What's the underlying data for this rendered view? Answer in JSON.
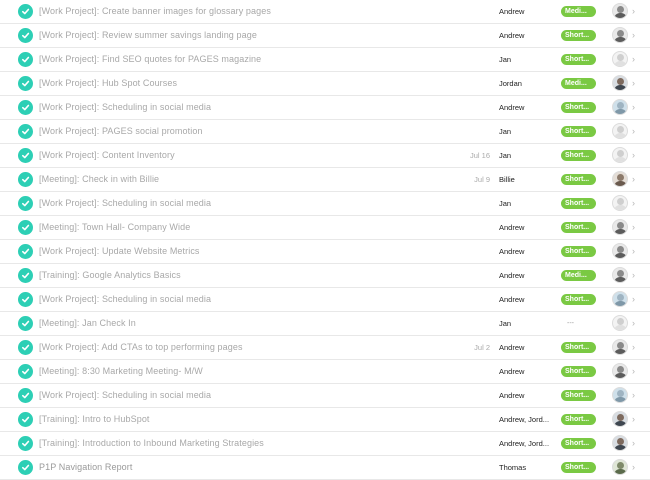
{
  "tasks": [
    {
      "name": "[Work Project]: Create banner images for glossary pages",
      "due": "",
      "assignee": "Andrew",
      "tag": "Medi...",
      "avatar": "andrew"
    },
    {
      "name": "[Work Project]: Review summer savings landing page",
      "due": "",
      "assignee": "Andrew",
      "tag": "Short...",
      "avatar": "andrew"
    },
    {
      "name": "[Work Project]: Find SEO quotes for PAGES magazine",
      "due": "",
      "assignee": "Jan",
      "tag": "Short...",
      "avatar": "jan"
    },
    {
      "name": "[Work Project]: Hub Spot Courses",
      "due": "",
      "assignee": "Jordan",
      "tag": "Medi...",
      "avatar": "jordan"
    },
    {
      "name": "[Work Project]: Scheduling in social media",
      "due": "",
      "assignee": "Andrew",
      "tag": "Short...",
      "avatar": "social"
    },
    {
      "name": "[Work Project]: PAGES social promotion",
      "due": "",
      "assignee": "Jan",
      "tag": "Short...",
      "avatar": "jan"
    },
    {
      "name": "[Work Project]: Content Inventory",
      "due": "Jul 16",
      "assignee": "Jan",
      "tag": "Short...",
      "avatar": "jan"
    },
    {
      "name": "[Meeting]: Check in with Billie",
      "due": "Jul 9",
      "assignee": "Billie",
      "tag": "Short...",
      "avatar": "billie"
    },
    {
      "name": "[Work Project]: Scheduling in social media",
      "due": "",
      "assignee": "Jan",
      "tag": "Short...",
      "avatar": "jan"
    },
    {
      "name": "[Meeting]: Town Hall- Company Wide",
      "due": "",
      "assignee": "Andrew",
      "tag": "Short...",
      "avatar": "andrew"
    },
    {
      "name": "[Work Project]: Update Website Metrics",
      "due": "",
      "assignee": "Andrew",
      "tag": "Short...",
      "avatar": "andrew"
    },
    {
      "name": "[Training]: Google Analytics Basics",
      "due": "",
      "assignee": "Andrew",
      "tag": "Medi...",
      "avatar": "andrew"
    },
    {
      "name": "[Work Project]: Scheduling in social media",
      "due": "",
      "assignee": "Andrew",
      "tag": "Short...",
      "avatar": "social"
    },
    {
      "name": "[Meeting]: Jan Check In",
      "due": "",
      "assignee": "Jan",
      "tag": "---",
      "avatar": "jan"
    },
    {
      "name": "[Work Project]: Add CTAs to top performing pages",
      "due": "Jul 2",
      "assignee": "Andrew",
      "tag": "Short...",
      "avatar": "andrew"
    },
    {
      "name": "[Meeting]: 8:30 Marketing Meeting- M/W",
      "due": "",
      "assignee": "Andrew",
      "tag": "Short...",
      "avatar": "andrew"
    },
    {
      "name": "[Work Project]: Scheduling in social media",
      "due": "",
      "assignee": "Andrew",
      "tag": "Short...",
      "avatar": "social"
    },
    {
      "name": "[Training]: Intro to HubSpot",
      "due": "",
      "assignee": "Andrew, Jord...",
      "tag": "Short...",
      "avatar": "jordan"
    },
    {
      "name": "[Training]: Introduction to Inbound Marketing Strategies",
      "due": "",
      "assignee": "Andrew, Jord...",
      "tag": "Short...",
      "avatar": "jordan"
    },
    {
      "name": "P1P Navigation Report",
      "due": "",
      "assignee": "Thomas",
      "tag": "Short...",
      "avatar": "thomas"
    }
  ],
  "colors": {
    "check": "#2dcfb5",
    "tag_green": "#7ac943",
    "done_text": "#a8a8a8"
  },
  "icons": {
    "check": "check-circle-icon",
    "chevron": "chevron-right-icon"
  }
}
